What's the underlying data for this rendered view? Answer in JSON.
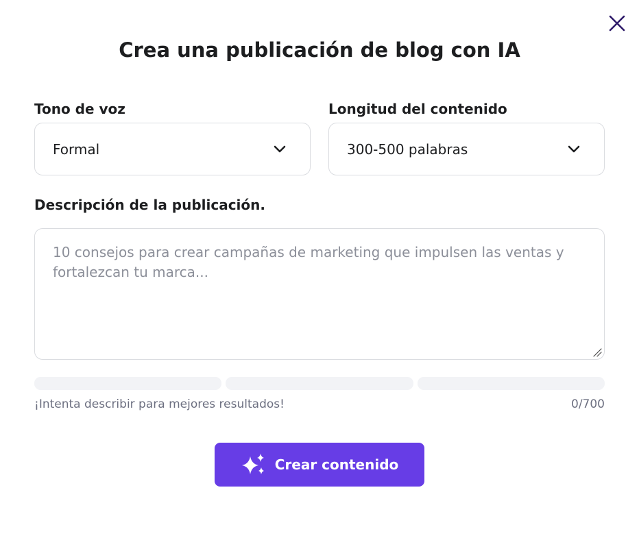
{
  "modal": {
    "title": "Crea una publicación de blog con IA",
    "close_icon": "close-icon"
  },
  "tone": {
    "label": "Tono de voz",
    "value": "Formal",
    "icon": "chevron-down-icon"
  },
  "length": {
    "label": "Longitud del contenido",
    "value": "300-500 palabras",
    "icon": "chevron-down-icon"
  },
  "description": {
    "label": "Descripción de la publicación.",
    "placeholder": "10 consejos para crear campañas de marketing que impulsen las ventas y fortalezcan tu marca...",
    "value": ""
  },
  "progress": {
    "segments": 3,
    "filled": 0
  },
  "hint": "¡Intenta describir para mejores resultados!",
  "counter": "0/700",
  "create_button": {
    "label": "Crear contenido",
    "icon": "sparkles-icon"
  },
  "colors": {
    "accent": "#673de6",
    "text": "#1d1e20",
    "muted": "#6d7081",
    "border": "#dadce0",
    "track": "#f2f3f6"
  }
}
